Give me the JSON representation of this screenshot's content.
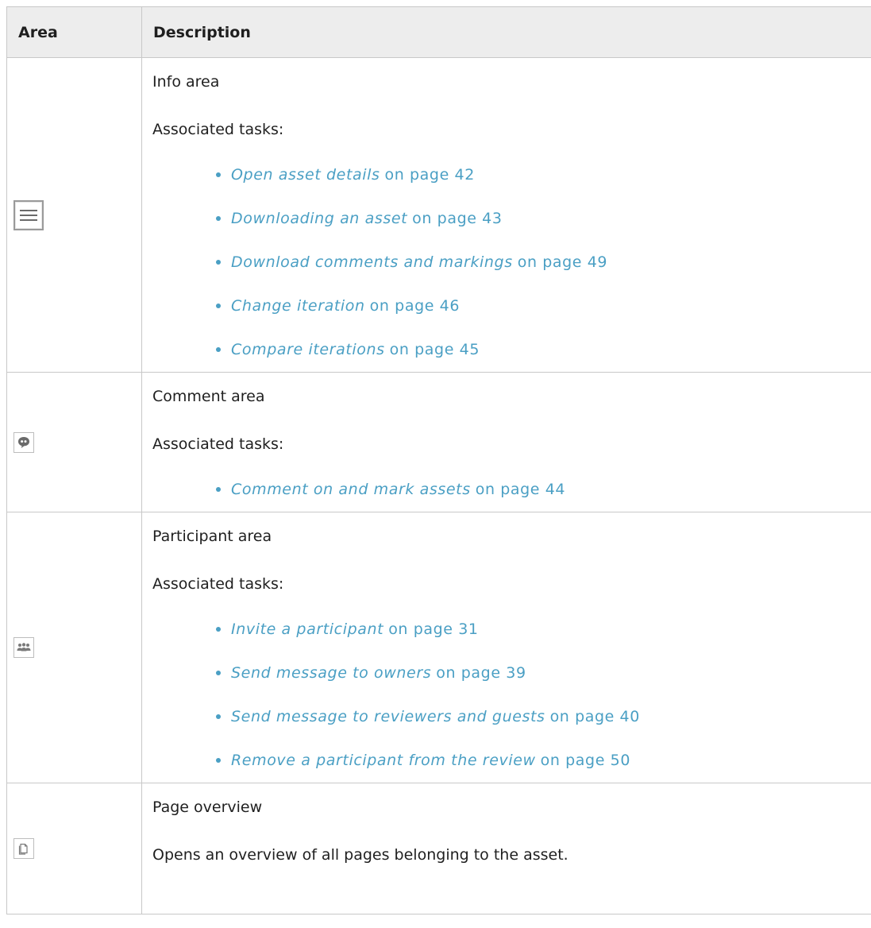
{
  "table": {
    "headers": {
      "area": "Area",
      "description": "Description"
    },
    "rows": [
      {
        "icon": "menu-lines-icon",
        "title": "Info area",
        "subtitle": "Associated tasks:",
        "tasks": [
          {
            "link": "Open asset details",
            "ref": "on page 42"
          },
          {
            "link": "Downloading an asset",
            "ref": "on page 43"
          },
          {
            "link": "Download comments and markings",
            "ref": "on page 49"
          },
          {
            "link": "Change iteration",
            "ref": "on page 46"
          },
          {
            "link": "Compare iterations",
            "ref": "on page 45"
          }
        ]
      },
      {
        "icon": "comment-bubble-icon",
        "title": "Comment area",
        "subtitle": "Associated tasks:",
        "tasks": [
          {
            "link": "Comment on and mark assets",
            "ref": "on page 44"
          }
        ]
      },
      {
        "icon": "participants-icon",
        "title": "Participant area",
        "subtitle": "Associated tasks:",
        "tasks": [
          {
            "link": "Invite a participant",
            "ref": "on page 31"
          },
          {
            "link": "Send message to owners",
            "ref": "on page 39"
          },
          {
            "link": "Send message to reviewers and guests",
            "ref": "on page 40"
          },
          {
            "link": "Remove a participant from the review",
            "ref": "on page 50"
          }
        ]
      },
      {
        "icon": "pages-icon",
        "title": "Page overview",
        "text": "Opens an overview of all pages belonging to the asset."
      }
    ]
  },
  "colors": {
    "link": "#4a9fc4",
    "header_bg": "#ededed",
    "border": "#c8c8c8"
  }
}
